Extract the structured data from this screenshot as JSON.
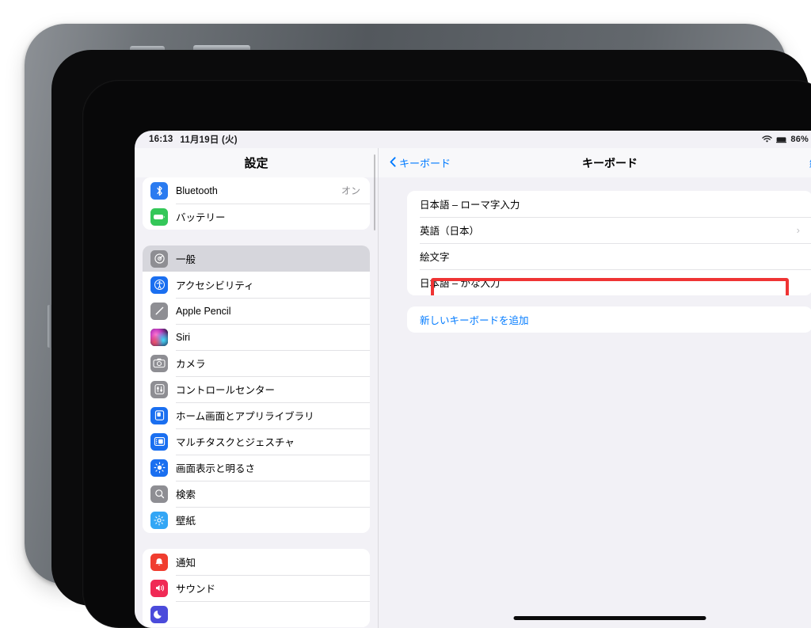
{
  "status_bar": {
    "time": "16:13",
    "date": "11月19日 (火)",
    "wifi_icon": "wifi-icon",
    "keyboard_icon": "magic-keyboard-icon",
    "battery_percent": "86%",
    "battery_icon": "battery-icon"
  },
  "sidebar": {
    "title": "設定",
    "groups": [
      {
        "items": [
          {
            "label": "Bluetooth",
            "value": "オン",
            "icon": "bluetooth-icon",
            "color": "#2a7bf0",
            "selected": false
          },
          {
            "label": "バッテリー",
            "value": "",
            "icon": "battery-icon",
            "color": "#34c759",
            "selected": false
          }
        ]
      },
      {
        "items": [
          {
            "label": "一般",
            "value": "",
            "icon": "gear-icon",
            "color": "#8e8e93",
            "selected": true
          },
          {
            "label": "アクセシビリティ",
            "value": "",
            "icon": "accessibility-icon",
            "color": "#1a6ff0",
            "selected": false
          },
          {
            "label": "Apple Pencil",
            "value": "",
            "icon": "pencil-icon",
            "color": "#8e8e93",
            "selected": false
          },
          {
            "label": "Siri",
            "value": "",
            "icon": "siri-icon",
            "color": "#2b2b36",
            "selected": false
          },
          {
            "label": "カメラ",
            "value": "",
            "icon": "camera-icon",
            "color": "#8e8e93",
            "selected": false
          },
          {
            "label": "コントロールセンター",
            "value": "",
            "icon": "control-center-icon",
            "color": "#8e8e93",
            "selected": false
          },
          {
            "label": "ホーム画面とアプリライブラリ",
            "value": "",
            "icon": "home-screen-icon",
            "color": "#1a6ff0",
            "selected": false
          },
          {
            "label": "マルチタスクとジェスチャ",
            "value": "",
            "icon": "multitasking-icon",
            "color": "#1a6ff0",
            "selected": false
          },
          {
            "label": "画面表示と明るさ",
            "value": "",
            "icon": "brightness-icon",
            "color": "#1a6ff0",
            "selected": false
          },
          {
            "label": "検索",
            "value": "",
            "icon": "search-icon",
            "color": "#8e8e93",
            "selected": false
          },
          {
            "label": "壁紙",
            "value": "",
            "icon": "wallpaper-icon",
            "color": "#33a6f5",
            "selected": false
          }
        ]
      },
      {
        "items": [
          {
            "label": "通知",
            "value": "",
            "icon": "notifications-icon",
            "color": "#f03d2f",
            "selected": false
          },
          {
            "label": "サウンド",
            "value": "",
            "icon": "sound-icon",
            "color": "#f02a55",
            "selected": false
          },
          {
            "label": "",
            "value": "",
            "icon": "focus-icon",
            "color": "#4b4bdb",
            "selected": false
          }
        ]
      }
    ]
  },
  "detail": {
    "back_label": "キーボード",
    "back_icon": "chevron-left-icon",
    "title": "キーボード",
    "edit_label": "編集",
    "keyboards": [
      {
        "label": "日本語 – ローマ字入力",
        "chevron": "",
        "highlighted": false
      },
      {
        "label": "英語（日本）",
        "chevron": "›",
        "highlighted": false
      },
      {
        "label": "絵文字",
        "chevron": "",
        "highlighted": false
      },
      {
        "label": "日本語 – かな入力",
        "chevron": "",
        "highlighted": true
      }
    ],
    "add_keyboard_label": "新しいキーボードを追加",
    "highlight_color": "#ef3434"
  }
}
